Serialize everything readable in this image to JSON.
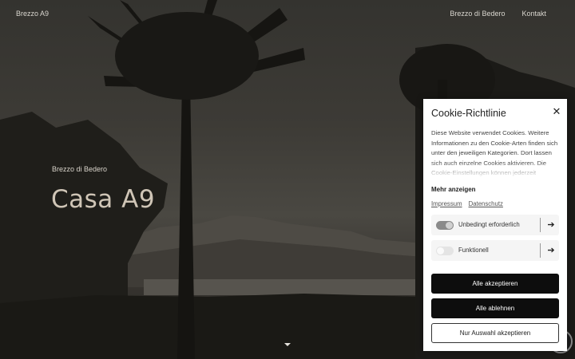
{
  "header": {
    "brand": "Brezzo A9",
    "nav": [
      {
        "label": "Brezzo di Bedero"
      },
      {
        "label": "Kontakt"
      }
    ]
  },
  "hero": {
    "subtitle": "Brezzo di Bedero",
    "title": "Casa A9"
  },
  "cookie": {
    "title": "Cookie-Richtlinie",
    "description": "Diese Website verwendet Cookies. Weitere Informationen zu den Cookie-Arten finden sich unter den jeweiligen Kategorien. Dort lassen sich auch einzelne Cookies aktivieren. Die Cookie-Einstellungen können jederzeit",
    "more_label": "Mehr anzeigen",
    "links": [
      {
        "label": "Impressum"
      },
      {
        "label": "Datenschutz"
      }
    ],
    "categories": [
      {
        "label": "Unbedingt erforderlich",
        "enabled": true
      },
      {
        "label": "Funktionell",
        "enabled": false
      }
    ],
    "buttons": {
      "accept_all": "Alle akzeptieren",
      "reject_all": "Alle ablehnen",
      "accept_selection": "Nur Auswahl akzeptieren"
    }
  },
  "icons": {
    "close": "close-icon",
    "arrow": "arrow-right-icon",
    "scroll": "chevron-down-icon",
    "chat": "chat-icon"
  },
  "colors": {
    "button_dark": "#0d0d0d",
    "toggle_on": "#8a8a8a",
    "toggle_off": "#e4e4e4"
  }
}
